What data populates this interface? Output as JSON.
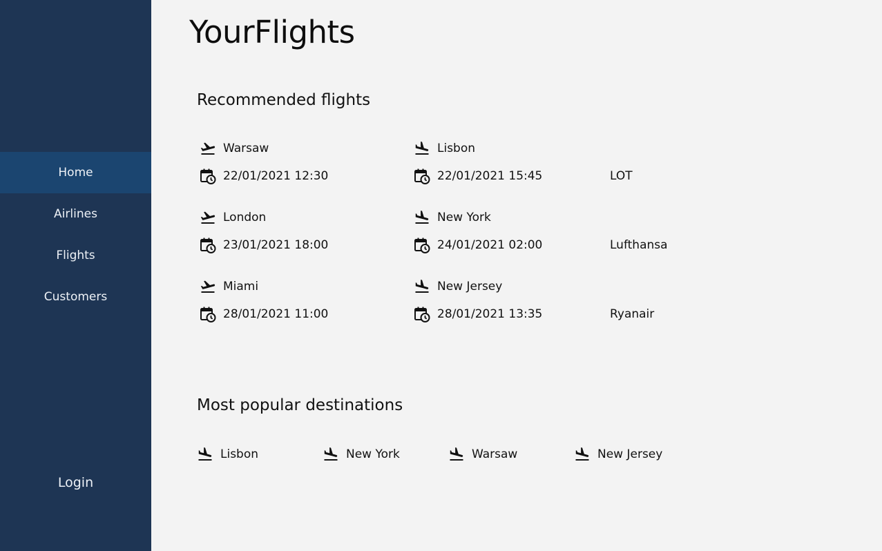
{
  "app": {
    "title": "YourFlights"
  },
  "sidebar": {
    "items": [
      {
        "label": "Home"
      },
      {
        "label": "Airlines"
      },
      {
        "label": "Flights"
      },
      {
        "label": "Customers"
      }
    ],
    "login_label": "Login",
    "active_item": "Home"
  },
  "recommended": {
    "title": "Recommended flights",
    "flights": [
      {
        "from": "Warsaw",
        "departure": "22/01/2021 12:30",
        "to": "Lisbon",
        "arrival": "22/01/2021 15:45",
        "airline": "LOT"
      },
      {
        "from": "London",
        "departure": "23/01/2021 18:00",
        "to": "New York",
        "arrival": "24/01/2021 02:00",
        "airline": "Lufthansa"
      },
      {
        "from": "Miami",
        "departure": "28/01/2021 11:00",
        "to": "New Jersey",
        "arrival": "28/01/2021 13:35",
        "airline": "Ryanair"
      }
    ]
  },
  "popular": {
    "title": "Most popular destinations",
    "destinations": [
      "Lisbon",
      "New York",
      "Warsaw",
      "New Jersey"
    ]
  },
  "icons": {
    "departure": "flight-takeoff-icon",
    "arrival": "flight-land-icon",
    "datetime": "calendar-clock-icon"
  },
  "colors": {
    "sidebar_bg": "#1e3554",
    "sidebar_active": "#1b4570",
    "page_bg": "#f3f3f3"
  }
}
